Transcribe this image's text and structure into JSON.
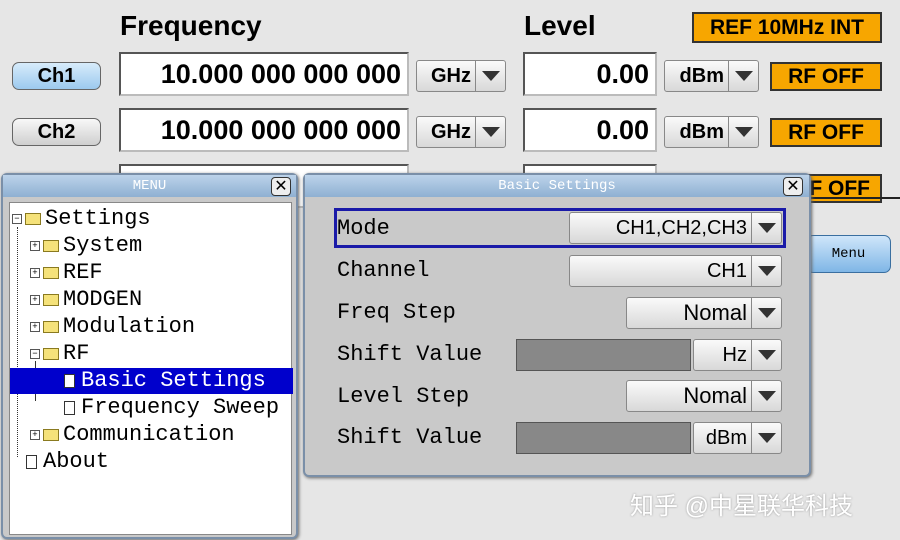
{
  "header": {
    "frequency": "Frequency",
    "level": "Level",
    "ref": "REF 10MHz INT"
  },
  "channels": [
    {
      "label": "Ch1",
      "freq": "10.000 000 000 000",
      "freq_unit": "GHz",
      "level": "0.00",
      "level_unit": "dBm",
      "rf": "RF OFF"
    },
    {
      "label": "Ch2",
      "freq": "10.000 000 000 000",
      "freq_unit": "GHz",
      "level": "0.00",
      "level_unit": "dBm",
      "rf": "RF OFF"
    },
    {
      "rf": "RF OFF"
    }
  ],
  "menu_button": "Menu",
  "menu_window": {
    "title": "MENU",
    "close": "✕",
    "items": [
      {
        "label": "Settings"
      },
      {
        "label": "System"
      },
      {
        "label": "REF"
      },
      {
        "label": "MODGEN"
      },
      {
        "label": "Modulation"
      },
      {
        "label": "RF"
      },
      {
        "label": "Basic Settings"
      },
      {
        "label": "Frequency Sweep"
      },
      {
        "label": "Communication"
      },
      {
        "label": "About"
      }
    ]
  },
  "basic_settings": {
    "title": "Basic Settings",
    "close": "✕",
    "rows": [
      {
        "label": "Mode",
        "value": "CH1,CH2,CH3"
      },
      {
        "label": "Channel",
        "value": "CH1"
      },
      {
        "label": "Freq Step",
        "value": "Nomal"
      },
      {
        "label": "Shift Value",
        "value": "Hz"
      },
      {
        "label": "Level Step",
        "value": "Nomal"
      },
      {
        "label": "Shift Value",
        "value": "dBm"
      }
    ]
  },
  "watermark": "知乎 @中星联华科技",
  "colors": {
    "accent_orange": "#f7a600",
    "selection": "#0000cc"
  }
}
